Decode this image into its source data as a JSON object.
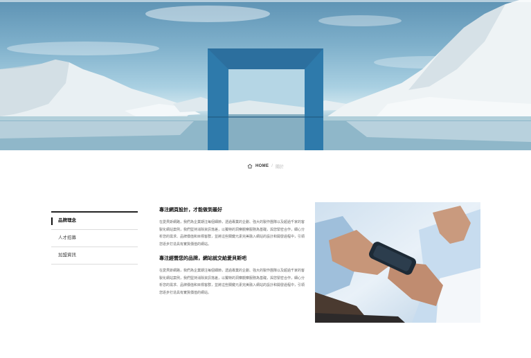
{
  "breadcrumb": {
    "home": "HOME",
    "separator": "/",
    "current": "關於",
    "home_icon": "home-icon"
  },
  "hero": {
    "alt": "glacier-lake-portal-image"
  },
  "sidebar": {
    "items": [
      {
        "label": "品牌理念",
        "active": true
      },
      {
        "label": "人才招募",
        "active": false
      },
      {
        "label": "加盟資訊",
        "active": false
      }
    ]
  },
  "content": {
    "sections": [
      {
        "title": "專注網頁設計，才能做到最好",
        "body": "在愛貝斯網路，我們為企業期注每個細節，透過專業的企劃、強大的製作團隊以及超過千家的客製化網站案例，我們堅持消除資訊落差，以獨特的洞察觀察服務為基礎，與您緊密合作，細心分析您的需求、品牌價值和目標客群，並將這些關鍵元素完美融入網站的設計和開發過程中，引領您逐步打造具有實質價值的網站。"
      },
      {
        "title": "專注經營您的品牌，網站就交給愛貝斯吧",
        "body": "在愛貝斯網路，我們為企業期注每個細節，透過專業的企劃、強大的製作團隊以及超過千家的客製化網站案例，我們堅持消除資訊落差，以獨特的洞察觀察服務為基礎，與您緊密合作，細心分析您的需求、品牌價值和目標客群，並將這些關鍵元素完美融入網站的設計和開發過程中，引領您逐步打造具有實質價值的網站。"
      }
    ]
  },
  "photo": {
    "alt": "business-people-using-smartphone"
  }
}
